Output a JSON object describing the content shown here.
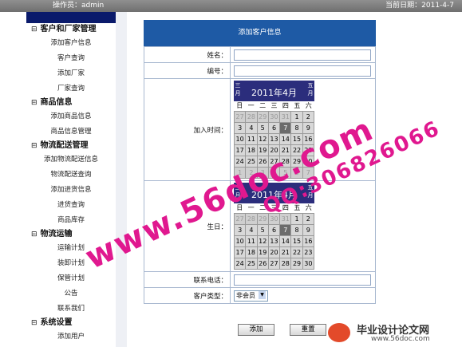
{
  "topbar": {
    "operator": "操作员：admin",
    "date": "当前日期：2011-4-7"
  },
  "sidebar": {
    "groups": [
      {
        "title": "客户和厂家管理",
        "toggle": "⊟",
        "items": [
          "添加客户信息",
          "客户查询",
          "添加厂家",
          "厂家查询"
        ]
      },
      {
        "title": "商品信息",
        "toggle": "⊟",
        "items": [
          "添加商品信息",
          "商品信息管理"
        ]
      },
      {
        "title": "物流配送管理",
        "toggle": "⊟",
        "items": [
          "添加物流配送信息",
          "物流配送查询",
          "添加进货信息",
          "进货查询",
          "商品库存"
        ]
      },
      {
        "title": "物流运输",
        "toggle": "⊟",
        "items": [
          "运输计划",
          "装卸计划",
          "保管计划",
          "公告",
          "联系我们"
        ]
      },
      {
        "title": "系统设置",
        "toggle": "⊟",
        "items": [
          "添加用户"
        ]
      }
    ]
  },
  "main": {
    "title": "添加客户信息",
    "labels": {
      "name": "姓名：",
      "number": "编号：",
      "join_time": "加入时间：",
      "birthday": "生日：",
      "phone": "联系电话：",
      "type": "客户类型："
    },
    "calendar1": {
      "title": "2011年4月",
      "prev": "三月",
      "next": "五月",
      "weekdays": [
        "日",
        "一",
        "二",
        "三",
        "四",
        "五",
        "六"
      ],
      "days": [
        "27",
        "28",
        "29",
        "30",
        "31",
        "1",
        "2",
        "3",
        "4",
        "5",
        "6",
        "7",
        "8",
        "9",
        "10",
        "11",
        "12",
        "13",
        "14",
        "15",
        "16",
        "17",
        "18",
        "19",
        "20",
        "21",
        "22",
        "23",
        "24",
        "25",
        "26",
        "27",
        "28",
        "29",
        "30",
        "1",
        "2",
        "3",
        "4",
        "5",
        "6",
        "7"
      ],
      "other_month": [
        0,
        1,
        2,
        3,
        4,
        35,
        36,
        37,
        38,
        39,
        40,
        41
      ],
      "today_index": 11
    },
    "calendar2": {
      "title": "2011年4月",
      "prev": "三月",
      "next": "五月",
      "weekdays": [
        "日",
        "一",
        "二",
        "三",
        "四",
        "五",
        "六"
      ],
      "days": [
        "27",
        "28",
        "29",
        "30",
        "31",
        "1",
        "2",
        "3",
        "4",
        "5",
        "6",
        "7",
        "8",
        "9",
        "10",
        "11",
        "12",
        "13",
        "14",
        "15",
        "16",
        "17",
        "18",
        "19",
        "20",
        "21",
        "22",
        "23",
        "24",
        "25",
        "26",
        "27",
        "28",
        "29",
        "30"
      ],
      "other_month": [
        0,
        1,
        2,
        3,
        4
      ],
      "today_index": 11
    },
    "customer_type": {
      "selected": "非会员"
    },
    "buttons": {
      "add": "添加",
      "reset": "重置"
    }
  },
  "watermark": {
    "site": "www.56doc.com",
    "qq": "QQ:306826066"
  },
  "logo": {
    "text": "毕业设计论文网",
    "url": "www.56doc.com",
    "color": "#e34a2a"
  }
}
